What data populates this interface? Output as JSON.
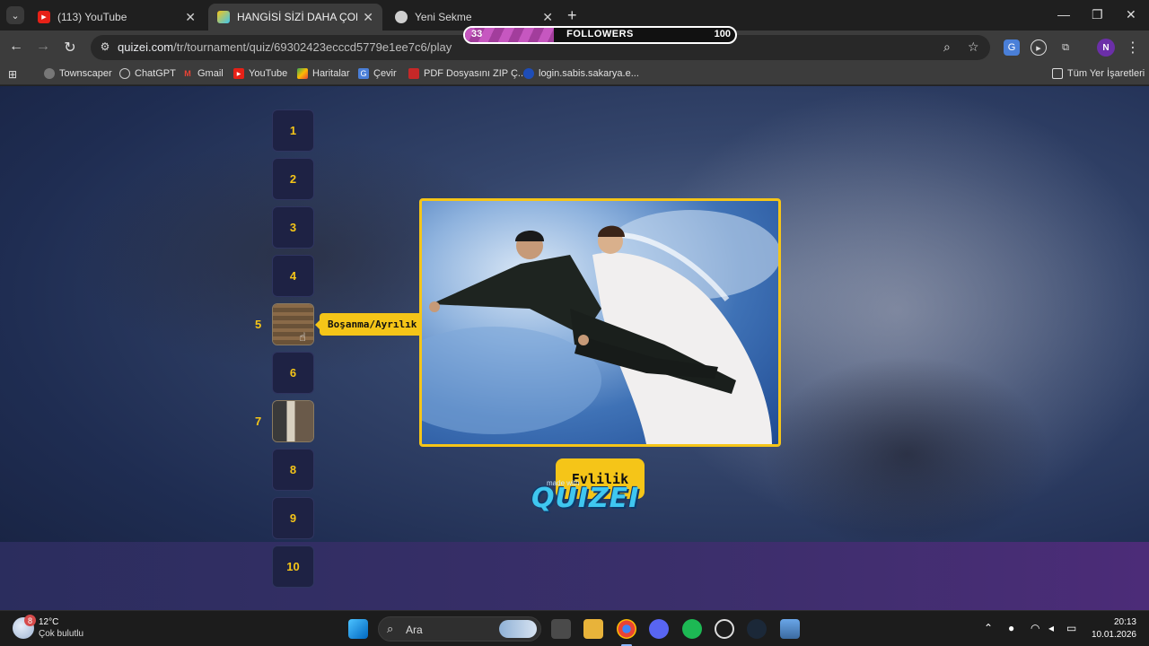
{
  "browser": {
    "tabs": [
      {
        "title": "(113) YouTube",
        "active": false,
        "favicon": "youtube-icon"
      },
      {
        "title": "HANGİSİ SİZİ DAHA ÇOK STRES",
        "active": true,
        "favicon": "quizei-icon"
      },
      {
        "title": "Yeni Sekme",
        "active": false,
        "favicon": "chrome-icon"
      }
    ],
    "url_host": "quizei.com",
    "url_path": "/tr/tournament/quiz/69302423ecccd5779e1ee7c6/play",
    "profile_initial": "N",
    "bookmarks": [
      {
        "label": "Townscaper"
      },
      {
        "label": "ChatGPT"
      },
      {
        "label": "Gmail"
      },
      {
        "label": "YouTube"
      },
      {
        "label": "Haritalar"
      },
      {
        "label": "Çevir"
      },
      {
        "label": "PDF Dosyasını ZIP Ç..."
      },
      {
        "label": "login.sabis.sakarya.e..."
      }
    ],
    "all_bookmarks_label": "Tüm Yer İşaretleri"
  },
  "followers": {
    "current": "33",
    "label": "FOLLOWERS",
    "goal": "100",
    "progress": 0.33
  },
  "quiz": {
    "slots": [
      {
        "label": "1"
      },
      {
        "label": "2"
      },
      {
        "label": "3"
      },
      {
        "label": "4"
      },
      {
        "label": "5",
        "filled": true
      },
      {
        "label": "6"
      },
      {
        "label": "7",
        "filled": true
      },
      {
        "label": "8"
      },
      {
        "label": "9"
      },
      {
        "label": "10"
      }
    ],
    "tooltip": "Boşanma/Ayrılık",
    "choice_label": "Evlilik",
    "logo_text": "QUIZEI",
    "logo_subtext": "made with"
  },
  "taskbar": {
    "temperature": "12°C",
    "weather": "Çok bulutlu",
    "weather_badge": "8",
    "search_placeholder": "Ara",
    "time": "20:13",
    "date": "10.01.2026"
  },
  "colors": {
    "accent_yellow": "#f5c518",
    "followers_fill": "#c657c0",
    "logo_blue": "#3fc7f0"
  }
}
